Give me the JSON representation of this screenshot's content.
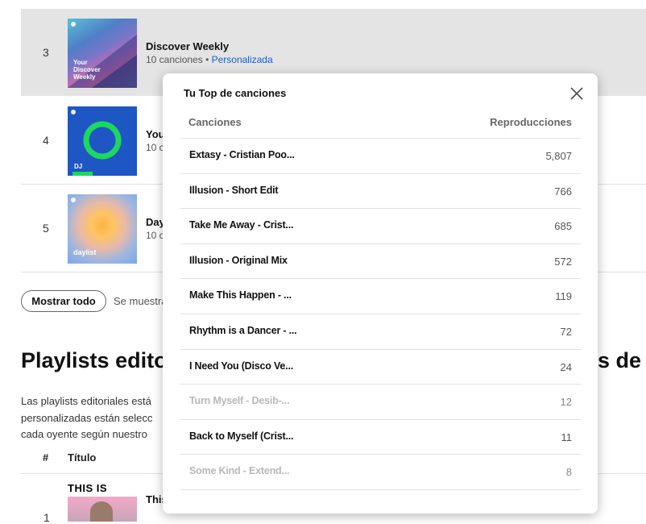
{
  "playlists": [
    {
      "num": "3",
      "title": "Discover Weekly",
      "count": "10 canciones",
      "separator": "•",
      "tag": "Personalizada",
      "cover_text": "Your\nDiscover\nWeekly"
    },
    {
      "num": "4",
      "title": "You",
      "count": "10 c",
      "cover_text": "DJ"
    },
    {
      "num": "5",
      "title": "Day",
      "count": "10 c",
      "cover_text": "daylist"
    }
  ],
  "show_all": {
    "label": "Mostrar todo",
    "note": "Se muestra"
  },
  "editorial": {
    "heading_left": "Playlists edito",
    "heading_right": "s de",
    "paragraph": [
      "Las playlists editoriales está",
      "personalizadas están selecc",
      "cada oyente según nuestro"
    ],
    "col_num": "#",
    "col_title": "Título",
    "row1_num": "1",
    "row1_title": "This",
    "row1_cover_text": "THIS IS"
  },
  "modal": {
    "title": "Tu Top de canciones",
    "col_songs": "Canciones",
    "col_plays": "Reproducciones",
    "rows": [
      {
        "song": "Extasy - Cristian Poo...",
        "plays": "5,807"
      },
      {
        "song": "Illusion - Short Edit",
        "plays": "766"
      },
      {
        "song": "Take Me Away - Crist...",
        "plays": "685"
      },
      {
        "song": "Illusion - Original Mix",
        "plays": "572"
      },
      {
        "song": "Make This Happen - ...",
        "plays": "119"
      },
      {
        "song": "Rhythm is a Dancer - ...",
        "plays": "72"
      },
      {
        "song": "I Need You (Disco Ve...",
        "plays": "24"
      },
      {
        "song": "Turn Myself - Desib-...",
        "plays": "12"
      },
      {
        "song": "Back to Myself (Crist...",
        "plays": "11"
      },
      {
        "song": "Some Kind - Extend...",
        "plays": "8"
      }
    ]
  },
  "colors": {
    "accent_link": "#1f5bc4",
    "highlight_row": "#e4e4e4",
    "dj_green": "#1ed760"
  },
  "icons": {
    "close": "close-icon"
  }
}
